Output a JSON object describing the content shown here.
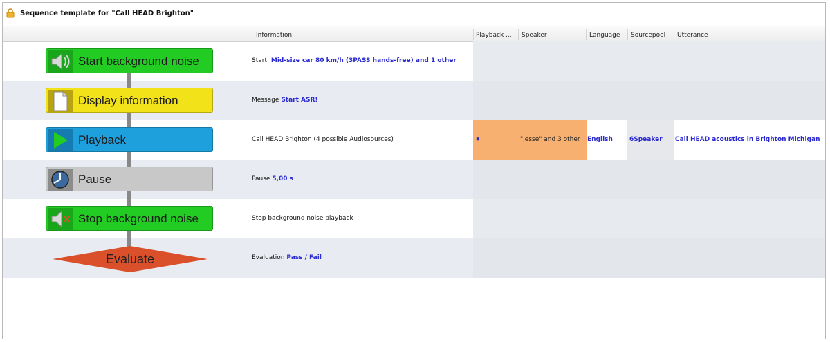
{
  "window": {
    "title": "Sequence template for \"Call HEAD Brighton\""
  },
  "columns": [
    "Information",
    "Playback ...",
    "Speaker",
    "Language",
    "Sourcepool",
    "Utterance"
  ],
  "steps": [
    {
      "label": "Start background noise",
      "info_prefix": "Start: ",
      "info_value": "Mid-size car 80 km/h (3PASS hands-free) and 1 other"
    },
    {
      "label": "Display information",
      "info_prefix": "Message ",
      "info_value": "Start ASR!"
    },
    {
      "label": "Playback",
      "info_prefix": "Call HEAD Brighton (4 possible Audiosources)",
      "info_value": ""
    },
    {
      "label": "Pause",
      "info_prefix": "Pause ",
      "info_value": "5,00 s"
    },
    {
      "label": "Stop background noise",
      "info_prefix": "Stop background noise playback",
      "info_value": ""
    },
    {
      "label": "Evaluate",
      "info_prefix": "Evaluation ",
      "info_value": "Pass / Fail"
    }
  ],
  "playback_row": {
    "playback_marker": "•",
    "speaker": "\"Jesse\" and 3 other",
    "language": "English",
    "sourcepool": "6Speaker",
    "utterance": "Call HEAD acoustics in Brighton Michigan"
  },
  "colors": {
    "green": "#22cc22",
    "yellow": "#f2e21a",
    "blue": "#1ea0dc",
    "gray": "#c8c8c8",
    "evaluate": "#d9502a",
    "selection_orange": "#f7b06f",
    "link_blue": "#2a2ad0"
  },
  "icons": [
    "lock-icon",
    "speaker-icon",
    "document-icon",
    "play-icon",
    "pause-clock-icon",
    "speaker-muted-icon"
  ]
}
